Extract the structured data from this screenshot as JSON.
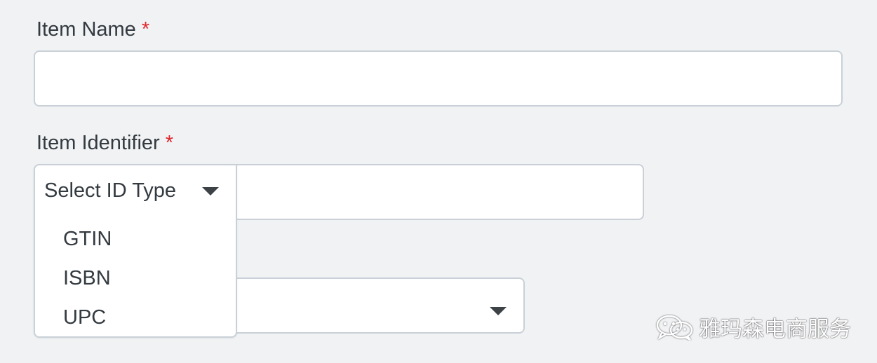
{
  "form": {
    "item_name": {
      "label": "Item Name",
      "required_marker": "*",
      "value": "",
      "placeholder": ""
    },
    "item_identifier": {
      "label": "Item Identifier",
      "required_marker": "*",
      "id_type_select": {
        "selected_label": "Select ID Type",
        "expanded": true,
        "options": [
          "GTIN",
          "ISBN",
          "UPC"
        ]
      },
      "value": "",
      "placeholder": ""
    },
    "lower_select": {
      "selected_label": ""
    }
  },
  "watermark": {
    "icon": "wechat-icon",
    "text": "雅玛森电商服务"
  },
  "colors": {
    "background": "#f1f2f4",
    "border": "#c9d0d8",
    "required": "#e0262b",
    "text": "#333a40"
  }
}
